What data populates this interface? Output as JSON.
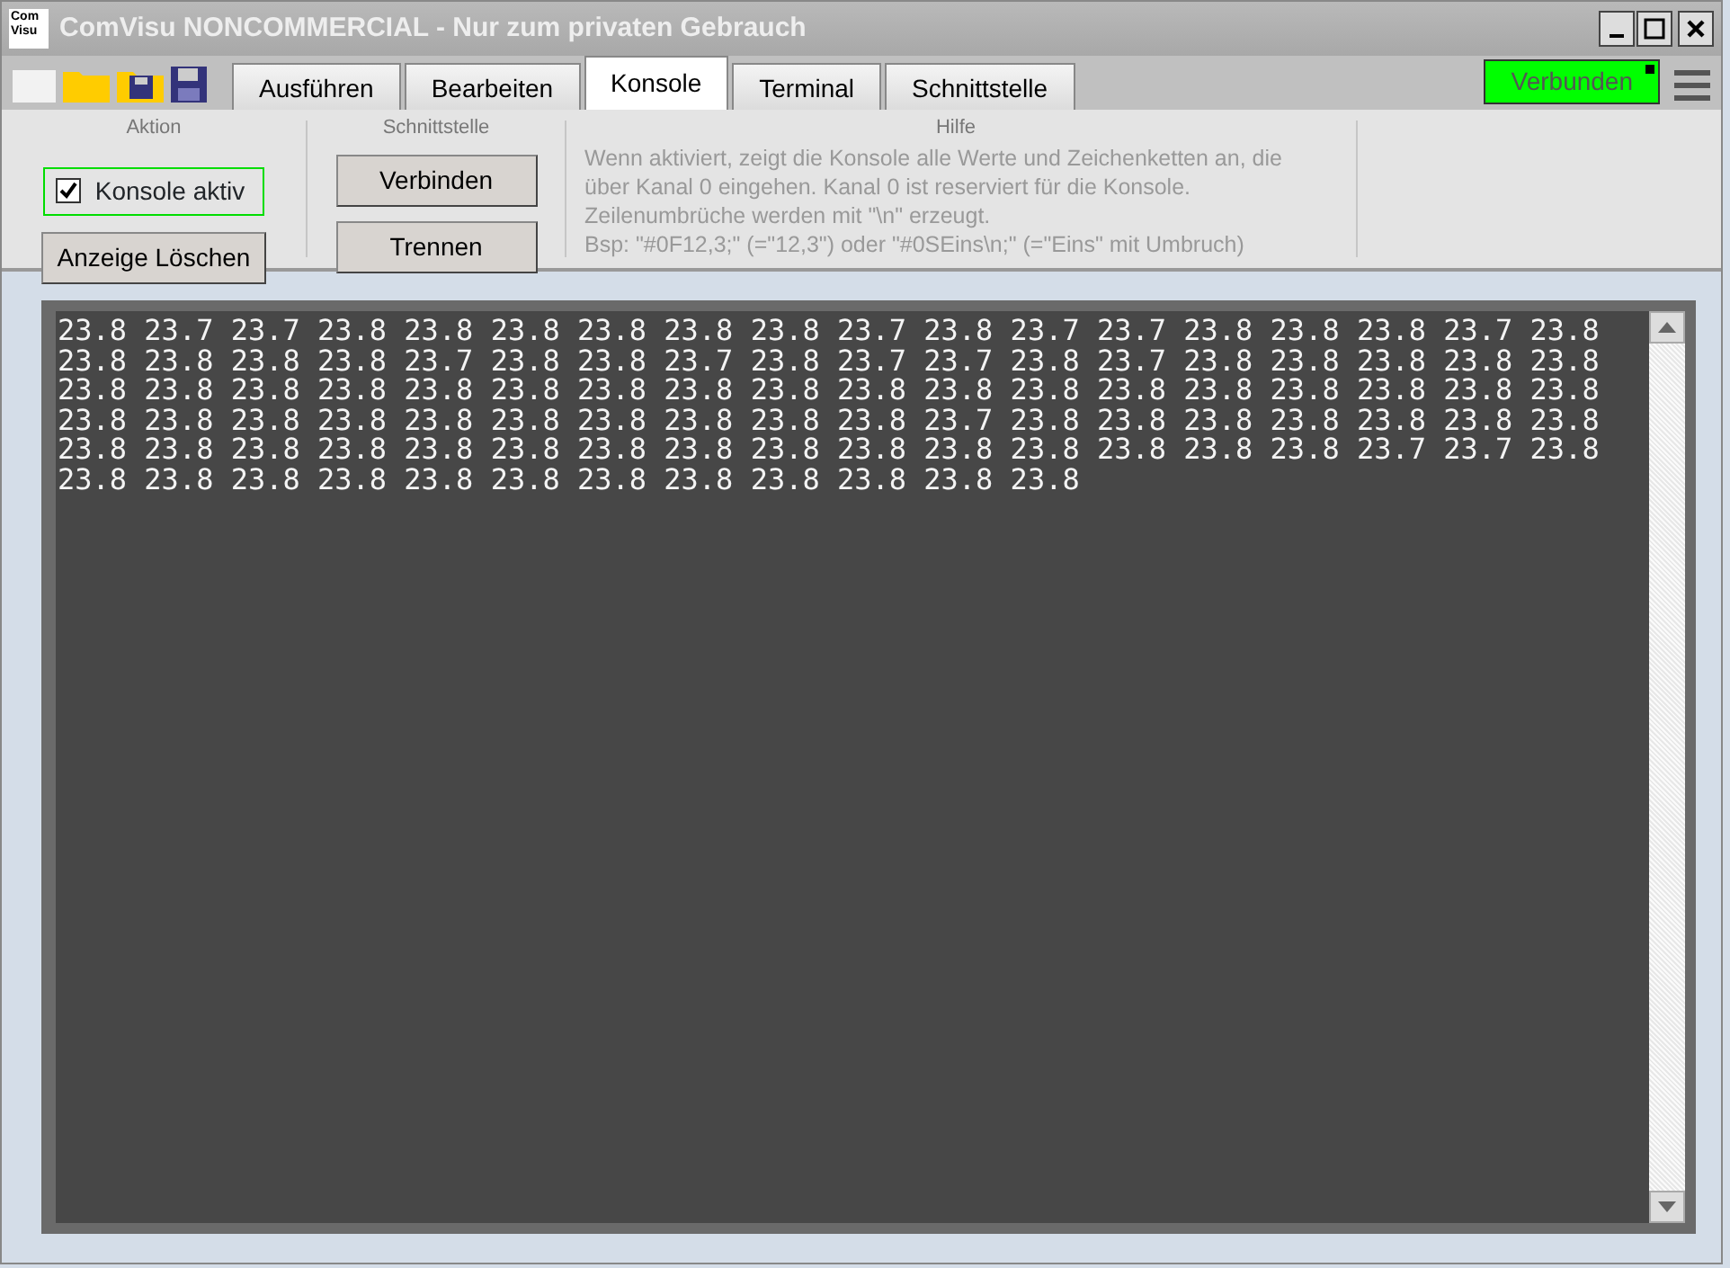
{
  "window": {
    "title": "ComVisu NONCOMMERCIAL - Nur zum privaten Gebrauch",
    "logo": "Com Visu"
  },
  "tabs": [
    {
      "label": "Ausführen",
      "selected": false
    },
    {
      "label": "Bearbeiten",
      "selected": false
    },
    {
      "label": "Konsole",
      "selected": true
    },
    {
      "label": "Terminal",
      "selected": false
    },
    {
      "label": "Schnittstelle",
      "selected": false
    }
  ],
  "status": {
    "label": "Verbunden",
    "connected": true
  },
  "groups": {
    "aktion": {
      "title": "Aktion",
      "checkbox": {
        "label": "Konsole aktiv",
        "checked": true
      },
      "clear_button": "Anzeige Löschen"
    },
    "schnittstelle": {
      "title": "Schnittstelle",
      "buttons": [
        "Verbinden",
        "Trennen"
      ]
    },
    "hilfe": {
      "title": "Hilfe",
      "lines": [
        "Wenn aktiviert, zeigt die Konsole alle Werte und Zeichenketten an, die",
        "über Kanal 0 eingehen. Kanal 0 ist reserviert für die Konsole.",
        "Zeilenumbrüche werden mit \"\\n\" erzeugt.",
        "Bsp: \"#0F12,3;\" (=\"12,3\") oder \"#0SEins\\n;\" (=\"Eins\" mit Umbruch)"
      ]
    }
  },
  "console": {
    "lines": [
      "23.8 23.7 23.7 23.8 23.8 23.8 23.8 23.8 23.8 23.7 23.8 23.7 23.7 23.8 23.8 23.8 23.7 23.8",
      "23.8 23.8 23.8 23.8 23.7 23.8 23.8 23.7 23.8 23.7 23.7 23.8 23.7 23.8 23.8 23.8 23.8 23.8",
      "23.8 23.8 23.8 23.8 23.8 23.8 23.8 23.8 23.8 23.8 23.8 23.8 23.8 23.8 23.8 23.8 23.8 23.8",
      "23.8 23.8 23.8 23.8 23.8 23.8 23.8 23.8 23.8 23.8 23.7 23.8 23.8 23.8 23.8 23.8 23.8 23.8",
      "23.8 23.8 23.8 23.8 23.8 23.8 23.8 23.8 23.8 23.8 23.8 23.8 23.8 23.8 23.8 23.7 23.7 23.8",
      "23.8 23.8 23.8 23.8 23.8 23.8 23.8 23.8 23.8 23.8 23.8 23.8"
    ]
  }
}
